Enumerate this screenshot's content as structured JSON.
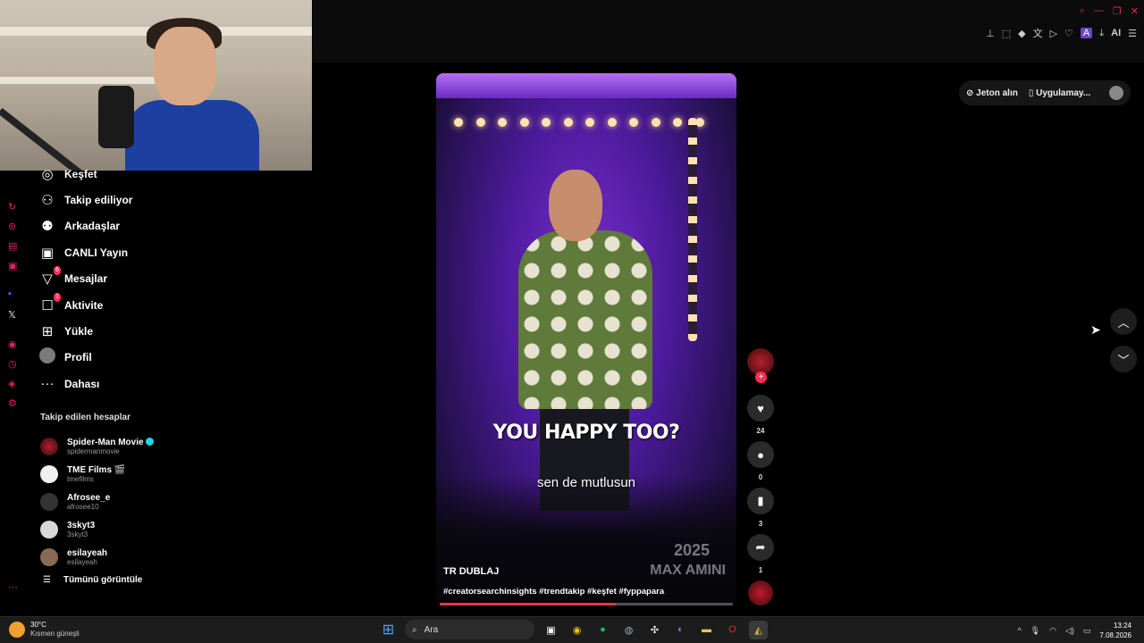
{
  "browser": {
    "window_controls": [
      "⌕",
      "—",
      "❐",
      "✕"
    ],
    "ai_label": "AI"
  },
  "sidebar": {
    "items": [
      {
        "label": "Keşfet",
        "icon": "compass-icon",
        "glyph": "◎"
      },
      {
        "label": "Takip ediliyor",
        "icon": "user-follow-icon",
        "glyph": "⚇"
      },
      {
        "label": "Arkadaşlar",
        "icon": "friends-icon",
        "glyph": "⚉"
      },
      {
        "label": "CANLI Yayın",
        "icon": "live-tv-icon",
        "glyph": "▣"
      },
      {
        "label": "Mesajlar",
        "icon": "send-icon",
        "glyph": "▽",
        "badge": "6"
      },
      {
        "label": "Aktivite",
        "icon": "activity-icon",
        "glyph": "☐",
        "badge": "1"
      },
      {
        "label": "Yükle",
        "icon": "upload-plus-icon",
        "glyph": "⊞"
      },
      {
        "label": "Profil",
        "icon": "profile-avatar",
        "glyph": ""
      },
      {
        "label": "Dahası",
        "icon": "more-dots-icon",
        "glyph": "···"
      }
    ],
    "following_title": "Takip edilen hesaplar",
    "following": [
      {
        "name": "Spider-Man Movie",
        "handle": "spidermanmovie",
        "verified": true
      },
      {
        "name": "TME Films 🎬",
        "handle": "tmefilms"
      },
      {
        "name": "Afrosee_e",
        "handle": "afrosee10"
      },
      {
        "name": "3skyt3",
        "handle": "3skyt3"
      },
      {
        "name": "esilayeah",
        "handle": "esilayeah"
      }
    ],
    "see_all": "Tümünü görüntüle"
  },
  "top_actions": {
    "coins": "Jeton alın",
    "app": "Uygulamay..."
  },
  "video": {
    "caption_en": "YOU HAPPY TOO?",
    "caption_tr": "sen de mutlusun",
    "watermark_year": "2025",
    "watermark_name": "MAX AMINI",
    "author": "TR DUBLAJ",
    "hashtags": "#creatorsearchinsights #trendtakip #keşfet #fyppapara",
    "progress": 0.6
  },
  "actions": {
    "likes": "24",
    "comments": "0",
    "saves": "3",
    "shares": "1"
  },
  "taskbar": {
    "temperature": "30°C",
    "weather": "Kısmen güneşli",
    "search_placeholder": "Ara",
    "time": "13:24",
    "date": "7.08.2026"
  }
}
